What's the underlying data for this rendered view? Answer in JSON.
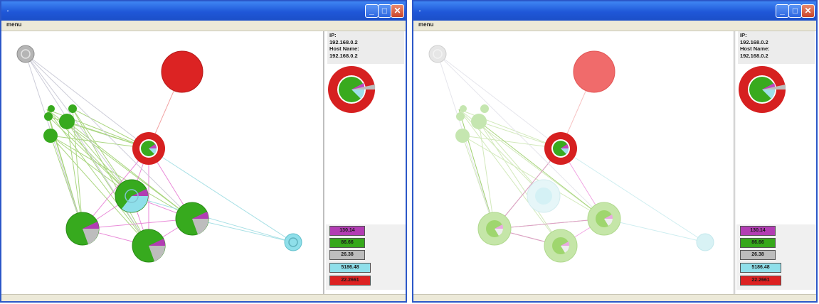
{
  "windows": [
    {
      "menu_label": "menu",
      "host": {
        "ip_label": "IP:",
        "ip_value": "192.168.0.2",
        "hostname_label": "Host Name:",
        "hostname_value": "192.168.0.2"
      },
      "legend": [
        {
          "label": "130.14",
          "color": "#b23db3"
        },
        {
          "label": "86.66",
          "color": "#36a81b"
        },
        {
          "label": "26.38",
          "color": "#bdbdbd"
        },
        {
          "label": "5186.48",
          "color": "#8fdfea"
        },
        {
          "label": "22.2661",
          "color": "#dd2222"
        }
      ]
    },
    {
      "menu_label": "menu",
      "host": {
        "ip_label": "IP:",
        "ip_value": "192.168.0.2",
        "hostname_label": "Host Name:",
        "hostname_value": "192.168.0.2"
      },
      "legend": [
        {
          "label": "130.14",
          "color": "#b23db3"
        },
        {
          "label": "86.66",
          "color": "#36a81b"
        },
        {
          "label": "26.38",
          "color": "#bdbdbd"
        },
        {
          "label": "5186.48",
          "color": "#8fdfea"
        },
        {
          "label": "22.2661",
          "color": "#dd2222"
        }
      ]
    }
  ],
  "icons": {
    "app": "window-icon",
    "minimize": "minimize-icon",
    "maximize": "maximize-icon",
    "close": "close-icon"
  }
}
